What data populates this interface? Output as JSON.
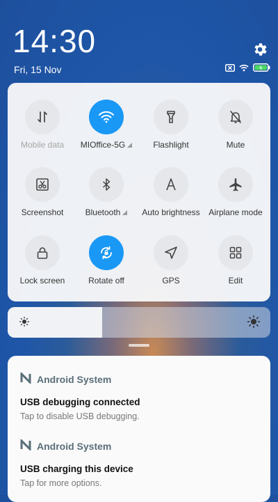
{
  "status_bar": {
    "time": "14:30",
    "date": "Fri, 15 Nov"
  },
  "quick_settings": {
    "tiles": [
      {
        "label": "Mobile data",
        "icon": "mobile-data-icon",
        "active": false,
        "disabled": true
      },
      {
        "label": "MIOffice-5G",
        "icon": "wifi-icon",
        "active": true
      },
      {
        "label": "Flashlight",
        "icon": "flashlight-icon",
        "active": false
      },
      {
        "label": "Mute",
        "icon": "bell-off-icon",
        "active": false
      },
      {
        "label": "Screenshot",
        "icon": "screenshot-icon",
        "active": false
      },
      {
        "label": "Bluetooth",
        "icon": "bluetooth-icon",
        "active": false
      },
      {
        "label": "Auto brightness",
        "icon": "auto-brightness-icon",
        "active": false
      },
      {
        "label": "Airplane mode",
        "icon": "airplane-icon",
        "active": false
      },
      {
        "label": "Lock screen",
        "icon": "lock-icon",
        "active": false
      },
      {
        "label": "Rotate off",
        "icon": "rotate-lock-icon",
        "active": true
      },
      {
        "label": "GPS",
        "icon": "gps-icon",
        "active": false
      },
      {
        "label": "Edit",
        "icon": "grid-icon",
        "active": false
      }
    ]
  },
  "brightness": {
    "level": 0.36
  },
  "notifications": [
    {
      "app": "Android System",
      "title": "USB debugging connected",
      "body": "Tap to disable USB debugging."
    },
    {
      "app": "Android System",
      "title": "USB charging this device",
      "body": "Tap for more options."
    }
  ],
  "colors": {
    "accent": "#1a98f5",
    "tile_bg": "#e6e7ea",
    "panel_bg": "#f5f6f8"
  }
}
